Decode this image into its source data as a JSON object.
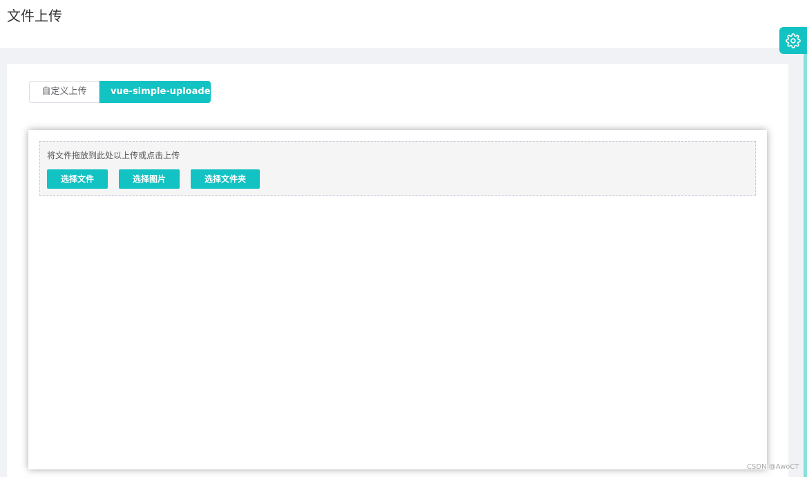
{
  "header": {
    "title": "文件上传"
  },
  "settings": {
    "icon": "gear-icon",
    "accent": "#13c2c2"
  },
  "tabs": [
    {
      "label": "自定义上传",
      "active": false
    },
    {
      "label": "vue-simple-uploader",
      "active": true
    }
  ],
  "uploader": {
    "drop_hint": "将文件拖放到此处以上传或点击上传",
    "buttons": {
      "select_file": "选择文件",
      "select_image": "选择图片",
      "select_folder": "选择文件夹"
    }
  },
  "watermark": "CSDN @AwoCT"
}
